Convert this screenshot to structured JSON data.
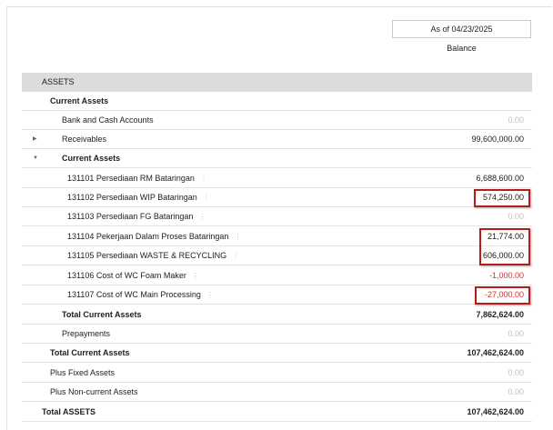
{
  "header": {
    "as_of": "As of 04/23/2025",
    "column_label": "Balance"
  },
  "rows": [
    {
      "label": "ASSETS",
      "amount": "",
      "kind": "section"
    },
    {
      "label": "Current Assets",
      "amount": "",
      "kind": "group"
    },
    {
      "label": "Bank and Cash Accounts",
      "amount": "0.00"
    },
    {
      "label": "Receivables",
      "amount": "99,600,000.00",
      "caret": "collapsed"
    },
    {
      "label": "Current Assets",
      "amount": "",
      "kind": "group",
      "caret": "expanded"
    },
    {
      "label": "131101 Persediaan RM Bataringan",
      "amount": "6,688,600.00"
    },
    {
      "label": "131102 Persediaan WIP Bataringan",
      "amount": "574,250.00"
    },
    {
      "label": "131103 Persediaan FG Bataringan",
      "amount": "0.00"
    },
    {
      "label": "131104 Pekerjaan Dalam Proses Bataringan",
      "amount": "21,774.00"
    },
    {
      "label": "131105 Persediaan WASTE & RECYCLING",
      "amount": "606,000.00"
    },
    {
      "label": "131106 Cost of WC Foam Maker",
      "amount": "-1,000.00"
    },
    {
      "label": "131107 Cost of WC Main Processing",
      "amount": "-27,000.00"
    },
    {
      "label": "Total Current Assets",
      "amount": "7,862,624.00",
      "kind": "total"
    },
    {
      "label": "Prepayments",
      "amount": "0.00"
    },
    {
      "label": "Total Current Assets",
      "amount": "107,462,624.00",
      "kind": "total"
    },
    {
      "label": "Plus Fixed Assets",
      "amount": "0.00"
    },
    {
      "label": "Plus Non-current Assets",
      "amount": "0.00"
    },
    {
      "label": "Total ASSETS",
      "amount": "107,462,624.00",
      "kind": "total"
    }
  ],
  "colors": {
    "negative": "#d32f2f",
    "highlight": "#b71c1c",
    "section_bg": "#dcdcdc"
  },
  "icons": {
    "expand": "caret-right-icon",
    "collapse": "caret-down-icon",
    "row_menu": "vertical-dots-icon"
  }
}
